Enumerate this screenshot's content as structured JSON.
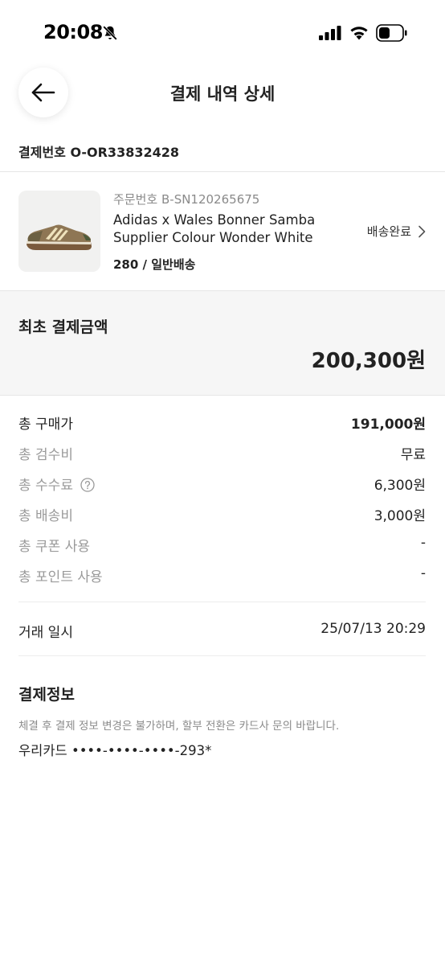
{
  "status_bar": {
    "time": "20:08",
    "icons": [
      "bell-slash-icon",
      "signal-icon",
      "wifi-icon",
      "battery-icon"
    ]
  },
  "header": {
    "title": "결제 내역 상세",
    "back_icon": "arrow-left-icon"
  },
  "payment": {
    "number_label": "결제번호",
    "number_value": "O-OR33832428"
  },
  "product": {
    "order_no_label": "주문번호",
    "order_no_value": "B-SN120265675",
    "name": "Adidas x Wales Bonner Samba Supplier Colour Wonder White",
    "option": "280 / 일반배송",
    "status": "배송완료",
    "status_icon": "chevron-right-icon"
  },
  "initial_payment": {
    "label": "최초 결제금액",
    "amount": "200,300원"
  },
  "breakdown": {
    "purchase_label": "총 구매가",
    "purchase_value": "191,000원",
    "inspection_label": "총 검수비",
    "inspection_value": "무료",
    "fee_label": "총 수수료",
    "fee_value": "6,300원",
    "shipping_label": "총 배송비",
    "shipping_value": "3,000원",
    "coupon_label": "총 쿠폰 사용",
    "coupon_value": "-",
    "point_label": "총 포인트 사용",
    "point_value": "-"
  },
  "transaction": {
    "label": "거래 일시",
    "value": "25/07/13 20:29"
  },
  "payment_info": {
    "title": "결제정보",
    "notice": "체결 후 결제 정보 변경은 불가하며, 할부 전환은 카드사 문의 바랍니다.",
    "card": "우리카드 ••••-••••-••••-293*"
  },
  "colors": {
    "muted_text": "#9a9a9a",
    "section_bg": "#f6f6f6",
    "divider": "#e6e6e6"
  }
}
